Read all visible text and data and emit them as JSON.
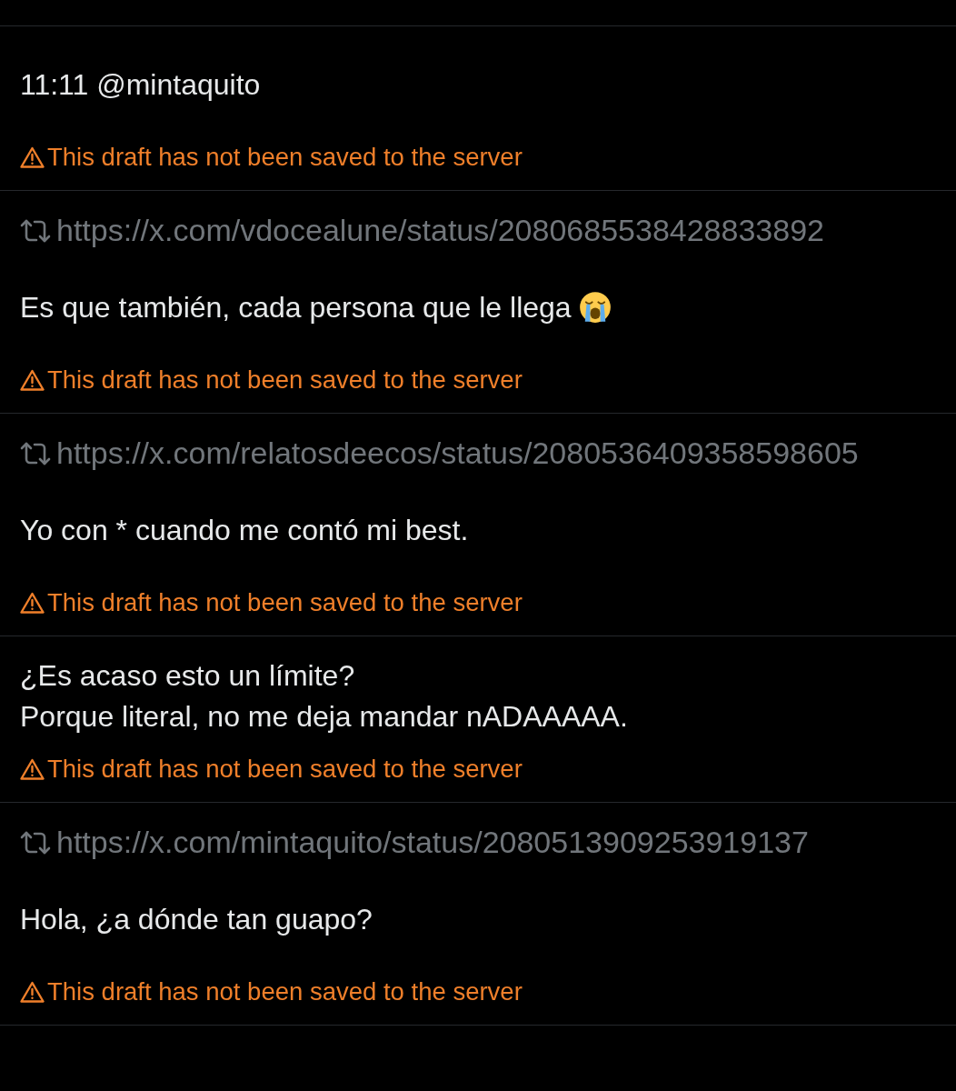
{
  "drafts": [
    {
      "lines": [
        "11:11 @mintaquito"
      ],
      "emoji": false,
      "warning": "This draft has not been saved to the server"
    },
    {
      "quote_url": "https://x.com/vdocealune/status/2080685538428833892",
      "lines": [
        "Es que también, cada persona que le llega"
      ],
      "emoji": true,
      "warning": "This draft has not been saved to the server"
    },
    {
      "quote_url": "https://x.com/relatosdeecos/status/2080536409358598605",
      "lines": [
        "Yo con * cuando me contó mi best."
      ],
      "emoji": false,
      "warning": "This draft has not been saved to the server"
    },
    {
      "lines": [
        "¿Es acaso esto un límite?",
        "Porque literal, no me deja mandar nADAAAAA."
      ],
      "emoji": false,
      "warning": "This draft has not been saved to the server"
    },
    {
      "quote_url": "https://x.com/mintaquito/status/2080513909253919137",
      "lines": [
        "Hola, ¿a dónde tan guapo?"
      ],
      "emoji": false,
      "warning": "This draft has not been saved to the server"
    }
  ]
}
